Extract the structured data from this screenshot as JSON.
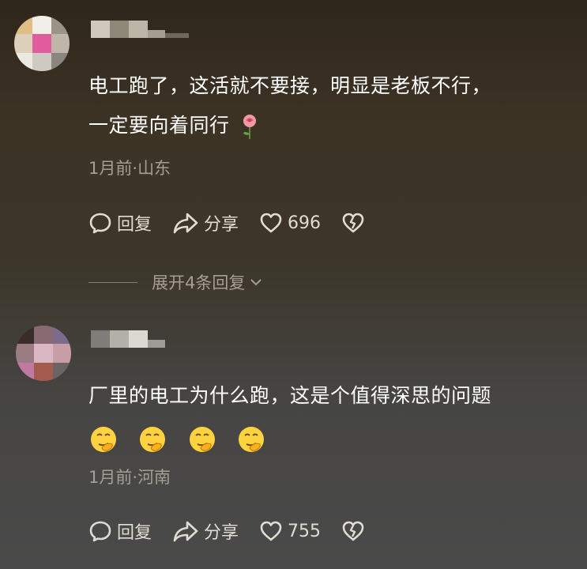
{
  "comments": [
    {
      "avatar_icon": "blurred-avatar-icon",
      "text_line1": "电工跑了，这活就不要接，明显是老板不行，",
      "text_line2": "一定要向着同行",
      "text_emoji": "rose-icon",
      "time": "1月前",
      "separator": "·",
      "location": "山东",
      "reply_label": "回复",
      "share_label": "分享",
      "like_count": "696",
      "expand_label": "展开4条回复"
    },
    {
      "avatar_icon": "blurred-avatar-icon",
      "text_line1": "厂里的电工为什么跑，这是个值得深思的问题",
      "emojis": [
        "thinking-hand-emoji",
        "thinking-hand-emoji",
        "thinking-hand-emoji",
        "thinking-hand-emoji"
      ],
      "time": "1月前",
      "separator": "·",
      "location": "河南",
      "reply_label": "回复",
      "share_label": "分享",
      "like_count": "755"
    }
  ],
  "colors": {
    "text": "#ffffff",
    "meta": "#a59e92",
    "action": "#e0dcd4"
  }
}
